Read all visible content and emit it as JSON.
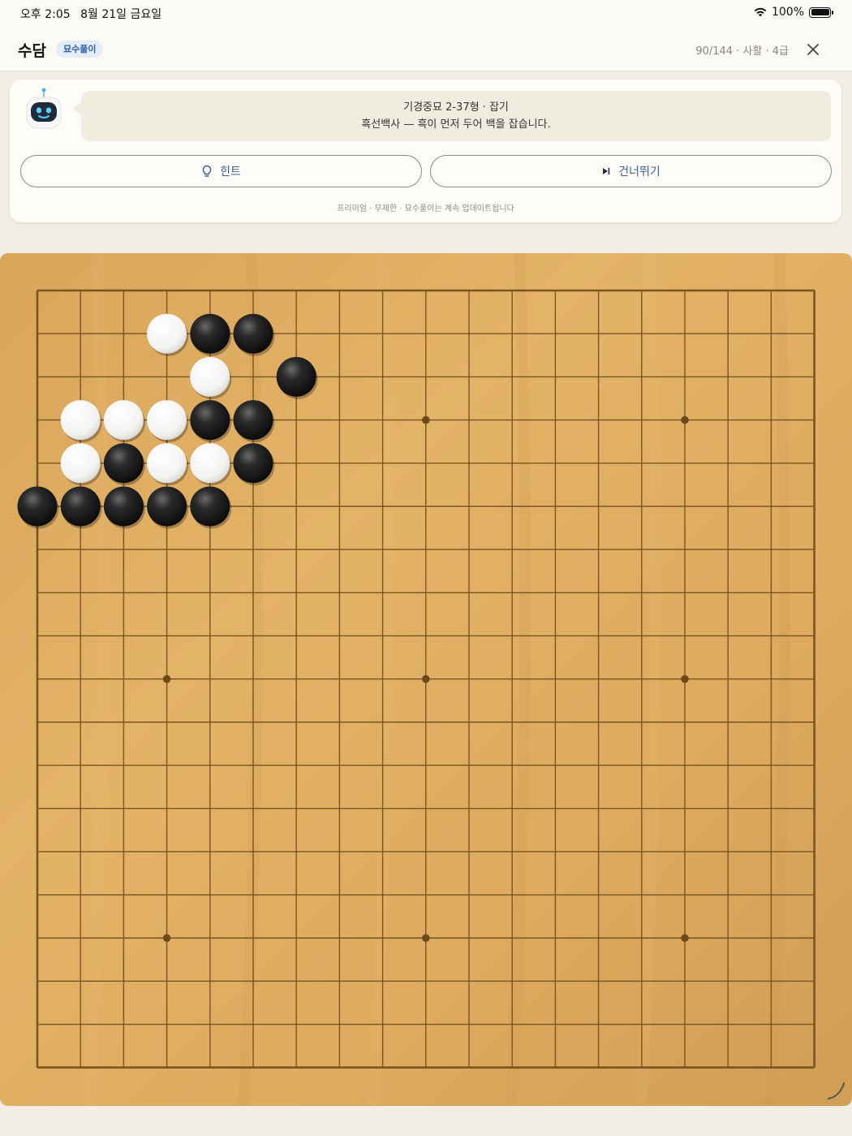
{
  "status_bar": {
    "time": "오후 2:05",
    "date": "8월 21일 금요일",
    "battery": "100%",
    "icons": [
      "wifi-icon",
      "battery-icon"
    ]
  },
  "header": {
    "title": "수담",
    "badge": "묘수풀이",
    "progress": "90/144 · 사활 · 4급",
    "close_icon": "close-icon"
  },
  "problem": {
    "avatar_icon": "robot-avatar-icon",
    "line1": "기경중묘 2-37형 · 잡기",
    "line2": "흑선백사 — 흑이 먼저 두어 백을 잡습니다.",
    "hint_label": "힌트",
    "hint_icon": "lightbulb-icon",
    "skip_label": "건너뛰기",
    "skip_icon": "skip-forward-icon",
    "footnote": "프리미엄 · 무제한 · 묘수풀이는 계속 업데이트됩니다"
  },
  "board": {
    "size": 19,
    "star_points": [
      [
        3,
        3
      ],
      [
        3,
        9
      ],
      [
        3,
        15
      ],
      [
        9,
        3
      ],
      [
        9,
        9
      ],
      [
        9,
        15
      ],
      [
        15,
        3
      ],
      [
        15,
        9
      ],
      [
        15,
        15
      ]
    ],
    "stones": [
      {
        "color": "white",
        "col": 3,
        "row": 1
      },
      {
        "color": "black",
        "col": 4,
        "row": 1
      },
      {
        "color": "black",
        "col": 5,
        "row": 1
      },
      {
        "color": "white",
        "col": 4,
        "row": 2
      },
      {
        "color": "black",
        "col": 6,
        "row": 2
      },
      {
        "color": "white",
        "col": 1,
        "row": 3
      },
      {
        "color": "white",
        "col": 2,
        "row": 3
      },
      {
        "color": "white",
        "col": 3,
        "row": 3
      },
      {
        "color": "black",
        "col": 4,
        "row": 3
      },
      {
        "color": "black",
        "col": 5,
        "row": 3
      },
      {
        "color": "white",
        "col": 1,
        "row": 4
      },
      {
        "color": "black",
        "col": 2,
        "row": 4
      },
      {
        "color": "white",
        "col": 3,
        "row": 4
      },
      {
        "color": "white",
        "col": 4,
        "row": 4
      },
      {
        "color": "black",
        "col": 5,
        "row": 4
      },
      {
        "color": "black",
        "col": 0,
        "row": 5
      },
      {
        "color": "black",
        "col": 1,
        "row": 5
      },
      {
        "color": "black",
        "col": 2,
        "row": 5
      },
      {
        "color": "black",
        "col": 3,
        "row": 5
      },
      {
        "color": "black",
        "col": 4,
        "row": 5
      }
    ]
  },
  "colors": {
    "board_wood": "#dfae61",
    "grid_line": "#7a5520",
    "badge_text": "#2d5fa8",
    "button_text": "#3e5f8c"
  }
}
